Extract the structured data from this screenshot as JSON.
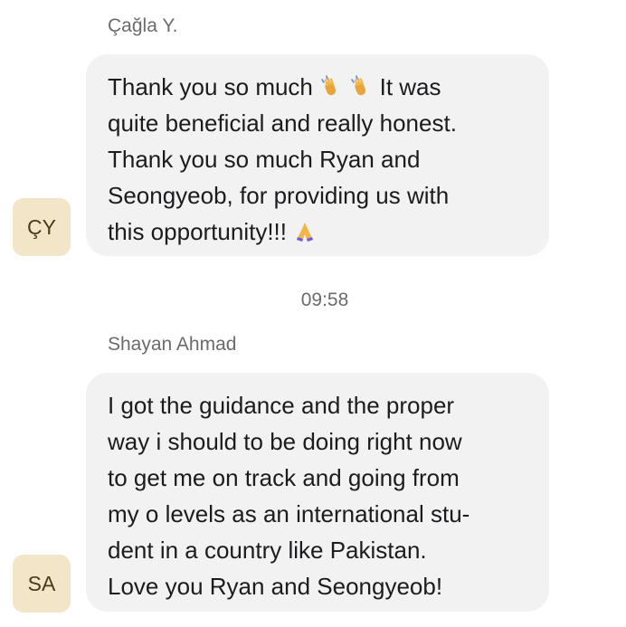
{
  "messages": [
    {
      "sender": "Çağla Y.",
      "avatar_initials": "ÇY",
      "line1_a": "Thank you so much",
      "line1_b": "It was",
      "line2": "quite beneficial and really honest.",
      "line3": "Thank you so much Ryan and",
      "line4": "Seongyeob, for providing us with",
      "line5": "this opportunity!!!",
      "emoji": [
        "clapping-hands",
        "clapping-hands",
        "folded-hands"
      ]
    },
    {
      "sender": "Shayan Ahmad",
      "avatar_initials": "SA",
      "lines": [
        "I got the guidance and the proper",
        "way i should to be doing right now",
        "to get me on track and going from",
        "my o levels as an international stu-",
        "dent in a country like Pakistan.",
        "Love you Ryan and Seongyeob!"
      ]
    }
  ],
  "timestamp": "09:58",
  "colors": {
    "bubble_bg": "#f2f2f3",
    "avatar_bg": "#f3e5c8",
    "meta_text": "#6b6b6b",
    "body_text": "#1c1c1e"
  }
}
